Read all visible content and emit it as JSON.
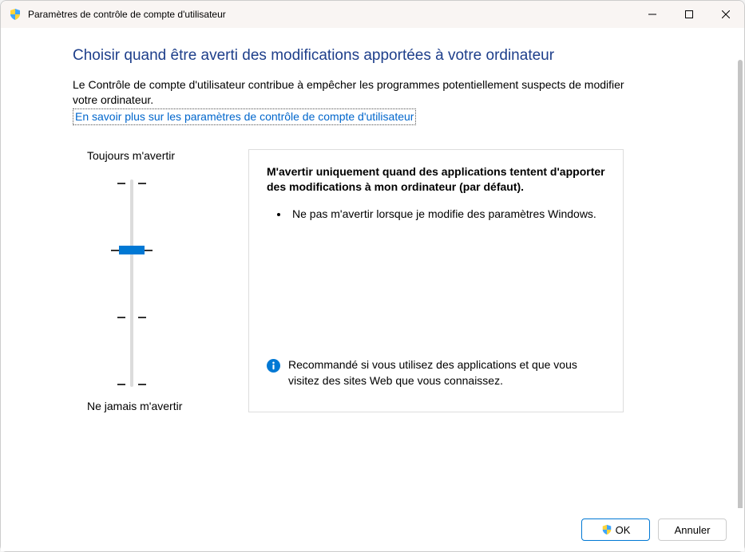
{
  "titlebar": {
    "title": "Paramètres de contrôle de compte d'utilisateur"
  },
  "heading": "Choisir quand être averti des modifications apportées à votre ordinateur",
  "description": "Le Contrôle de compte d'utilisateur contribue à empêcher les programmes potentiellement suspects de modifier votre ordinateur.",
  "learn_more_link": "En savoir plus sur les paramètres de contrôle de compte d'utilisateur",
  "slider": {
    "top_label": "Toujours m'avertir",
    "bottom_label": "Ne jamais m'avertir",
    "level_count": 4,
    "current_level_index": 1
  },
  "card": {
    "title": "M'avertir uniquement quand des applications tentent d'apporter des modifications à mon ordinateur (par défaut).",
    "bullets": [
      "Ne pas m'avertir lorsque je modifie des paramètres Windows."
    ],
    "recommendation": "Recommandé si vous utilisez des applications et que vous visitez des sites Web que vous connaissez."
  },
  "footer": {
    "ok": "OK",
    "cancel": "Annuler"
  }
}
